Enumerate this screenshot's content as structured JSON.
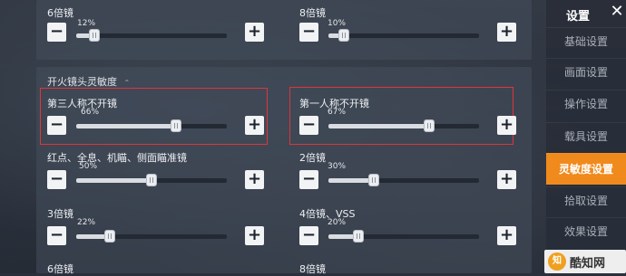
{
  "sidebar": {
    "title": "设置",
    "close": "✕",
    "items": [
      {
        "label": "基础设置",
        "active": false
      },
      {
        "label": "画面设置",
        "active": false
      },
      {
        "label": "操作设置",
        "active": false
      },
      {
        "label": "载具设置",
        "active": false
      },
      {
        "label": "灵敏度设置",
        "active": true
      },
      {
        "label": "拾取设置",
        "active": false
      },
      {
        "label": "效果设置",
        "active": false
      }
    ]
  },
  "section": {
    "title": "开火镜头灵敏度",
    "chevron": "⌃"
  },
  "settings": {
    "top_left": {
      "label": "6倍镜",
      "percent": "12%",
      "value": 12
    },
    "top_right": {
      "label": "8倍镜",
      "percent": "10%",
      "value": 10
    },
    "tp_no_scope": {
      "label": "第三人称不开镜",
      "percent": "66%",
      "value": 66
    },
    "fp_no_scope": {
      "label": "第一人称不开镜",
      "percent": "67%",
      "value": 67
    },
    "red_dot": {
      "label": "红点、全息、机瞄、侧面瞄准镜",
      "percent": "50%",
      "value": 50
    },
    "scope_2x": {
      "label": "2倍镜",
      "percent": "30%",
      "value": 30
    },
    "scope_3x": {
      "label": "3倍镜",
      "percent": "22%",
      "value": 22
    },
    "scope_4x": {
      "label": "4倍镜、VSS",
      "percent": "20%",
      "value": 20
    },
    "bottom_left": {
      "label": "6倍镜"
    },
    "bottom_right": {
      "label": "8倍镜"
    }
  },
  "controls": {
    "minus": "−",
    "plus": "+"
  },
  "watermark": {
    "text": "酷知网",
    "logo": "知"
  },
  "colors": {
    "accent": "#f08a1c",
    "highlight": "#e0353a"
  }
}
